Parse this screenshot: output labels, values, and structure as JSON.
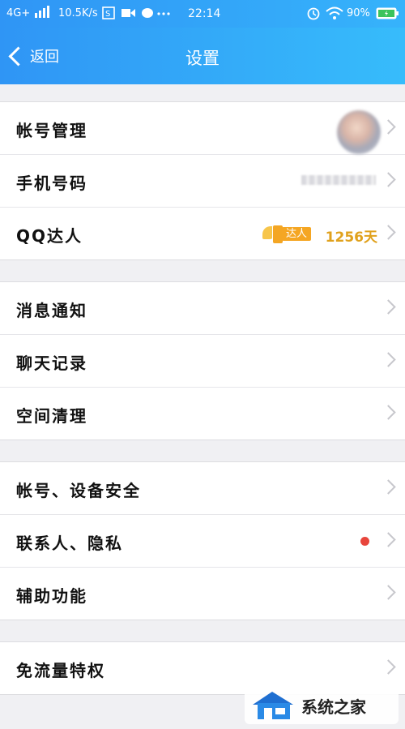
{
  "status_bar": {
    "network": "4G+",
    "speed": "10.5K/s",
    "time": "22:14",
    "battery": "90%"
  },
  "nav": {
    "back_label": "返回",
    "title": "设置"
  },
  "sections": [
    {
      "rows": [
        {
          "label": "帐号管理",
          "accessory": "avatar"
        },
        {
          "label": "手机号码",
          "accessory": "masked"
        },
        {
          "label": "QQ达人",
          "accessory": "qq-badge",
          "badge_text": "达人",
          "days": "1256天"
        }
      ]
    },
    {
      "rows": [
        {
          "label": "消息通知"
        },
        {
          "label": "聊天记录"
        },
        {
          "label": "空间清理"
        }
      ]
    },
    {
      "rows": [
        {
          "label": "帐号、设备安全"
        },
        {
          "label": "联系人、隐私",
          "accessory": "red-dot"
        },
        {
          "label": "辅助功能"
        }
      ]
    },
    {
      "rows": [
        {
          "label": "免流量特权"
        }
      ]
    }
  ],
  "watermark": {
    "text": "系统之家"
  }
}
